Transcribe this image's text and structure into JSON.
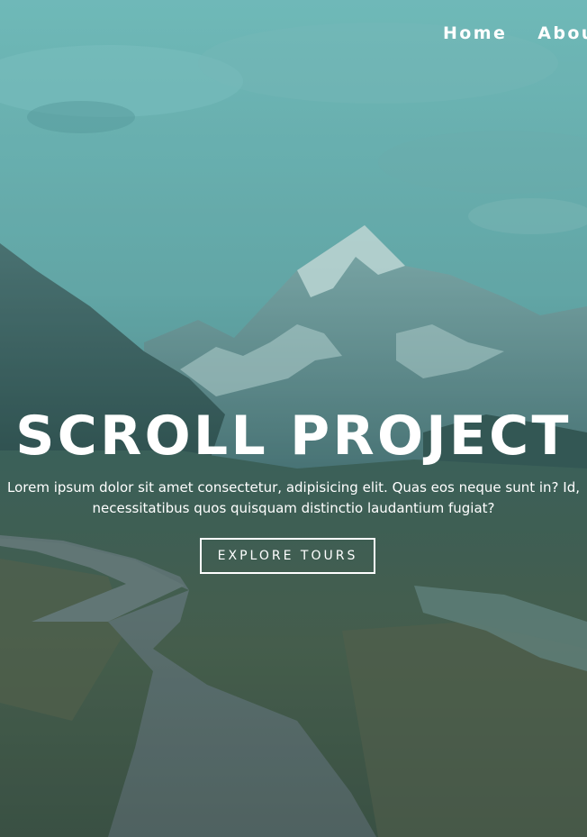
{
  "nav": {
    "links": [
      {
        "label": "Home"
      },
      {
        "label": "About"
      }
    ]
  },
  "hero": {
    "title": "SCROLL PROJECT",
    "subtitle_line1": "Lorem ipsum dolor sit amet consectetur, adipisicing elit. Quas eos neque sunt in? Id,",
    "subtitle_line2": "necessitatibus quos quisquam distinctio laudantium fugiat?",
    "button_label": "EXPLORE TOURS",
    "overlay_color": "#2f6d6d"
  }
}
